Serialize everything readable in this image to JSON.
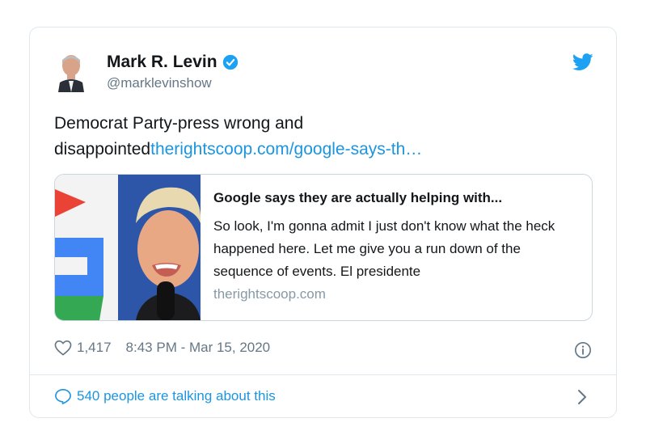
{
  "author": {
    "name": "Mark R. Levin",
    "handle": "@marklevinshow"
  },
  "tweet": {
    "text": "Democrat Party-press wrong and disappointed",
    "link_text": "therightscoop.com/google-says-th…"
  },
  "link_card": {
    "title": "Google says they are actually helping with...",
    "description": "So look, I'm gonna admit I just don't know what the heck happened here. Let me give you a run down of the sequence of events. El presidente",
    "domain": "therightscoop.com"
  },
  "meta": {
    "likes": "1,417",
    "timestamp": "8:43 PM - Mar 15, 2020"
  },
  "footer": {
    "talking": "540 people are talking about this"
  },
  "icons": {
    "verified": "verified-badge-icon",
    "bird": "twitter-bird-icon",
    "heart": "heart-icon",
    "info": "info-icon",
    "bubble": "speech-bubble-icon",
    "chevron": "chevron-right-icon"
  },
  "colors": {
    "link": "#1b95e0",
    "muted": "#657786",
    "border": "#e1e8ed"
  }
}
